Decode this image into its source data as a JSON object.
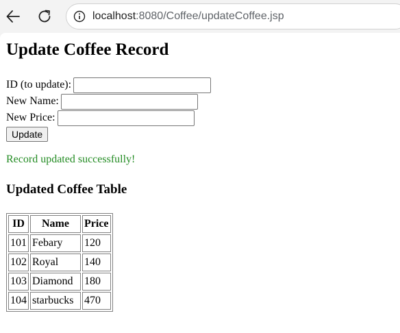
{
  "browser": {
    "url_host": "localhost",
    "url_path": ":8080/Coffee/updateCoffee.jsp"
  },
  "page": {
    "title": "Update Coffee Record",
    "form": {
      "id_label": "ID (to update):",
      "name_label": "New Name:",
      "price_label": "New Price:",
      "id_value": "",
      "name_value": "",
      "price_value": "",
      "submit_label": "Update"
    },
    "message": "Record updated successfully!",
    "message_color": "#228b22",
    "table_title": "Updated Coffee Table",
    "table": {
      "headers": [
        "ID",
        "Name",
        "Price"
      ],
      "rows": [
        [
          "101",
          "Febary",
          "120"
        ],
        [
          "102",
          "Royal",
          "140"
        ],
        [
          "103",
          "Diamond",
          "180"
        ],
        [
          "104",
          "starbucks",
          "470"
        ]
      ]
    }
  }
}
